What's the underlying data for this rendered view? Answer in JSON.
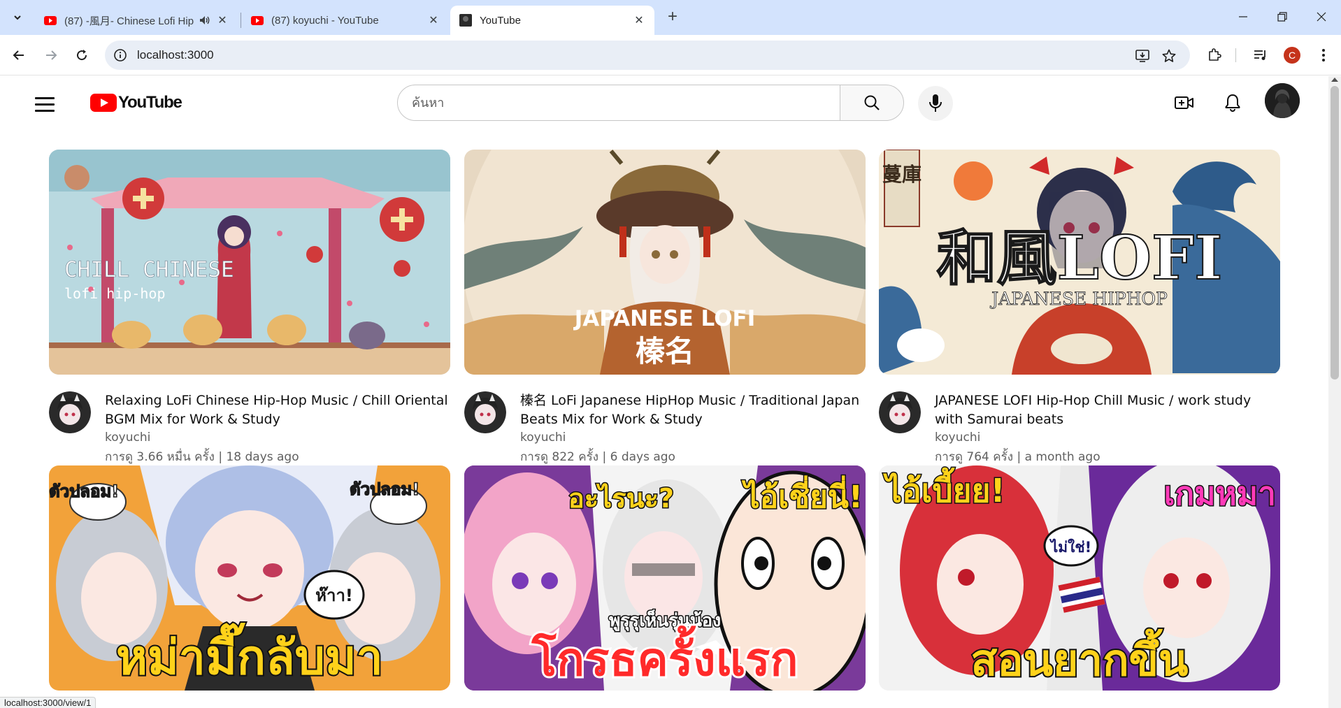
{
  "browser": {
    "tabs": [
      {
        "title": "(87) -風月- Chinese Lofi Hip",
        "favicon": "youtube-icon",
        "audio": true,
        "active": false
      },
      {
        "title": "(87) koyuchi - YouTube",
        "favicon": "youtube-icon",
        "audio": false,
        "active": false
      },
      {
        "title": "YouTube",
        "favicon": "dark-thumb-icon",
        "audio": false,
        "active": true
      }
    ],
    "url": "localhost:3000",
    "profile_initial": "C",
    "status_url": "localhost:3000/view/1"
  },
  "youtube": {
    "logo_text": "YouTube",
    "search": {
      "placeholder": "ค้นหา",
      "value": ""
    },
    "videos": [
      {
        "title": "Relaxing LoFi Chinese Hip-Hop Music / Chill Oriental BGM Mix for Work & Study",
        "channel": "koyuchi",
        "stats": "การดู 3.66 หมื่น ครั้ง | 18 days ago",
        "thumb_text_1": "CHILL CHINESE",
        "thumb_text_2": "lofi hip-hop"
      },
      {
        "title": "榛名 LoFi Japanese HipHop Music / Traditional Japan Beats Mix for Work & Study",
        "channel": "koyuchi",
        "stats": "การดู 822 ครั้ง | 6 days ago",
        "thumb_text_1": "JAPANESE LOFI",
        "thumb_text_2": "榛名"
      },
      {
        "title": "JAPANESE LOFI Hip-Hop Chill Music / work study with Samurai beats",
        "channel": "koyuchi",
        "stats": "การดู 764 ครั้ง | a month ago",
        "thumb_text_1": "和風LOFI",
        "thumb_text_2": "JAPANESE HIPHOP",
        "thumb_text_3": "蔓庫"
      },
      {
        "thumb_text_1": "หม่ามี๊กลับมา",
        "thumb_text_2": "ตัวปลอม!",
        "thumb_text_3": "ตัวปลอม!",
        "thumb_text_4": "ห๊าา!"
      },
      {
        "thumb_text_1": "โกรธครั้งแรก",
        "thumb_text_2": "อะไรนะ?",
        "thumb_text_3": "ไอ้เชี่ยนี่!",
        "thumb_text_4": "พูรุรุเห็นรุ่นน้อง"
      },
      {
        "thumb_text_1": "สอนยากขึ้น",
        "thumb_text_2": "ไอ้เบี้ยย!",
        "thumb_text_3": "เกมหมา",
        "thumb_text_4": "ไม่ใช่!"
      }
    ]
  }
}
